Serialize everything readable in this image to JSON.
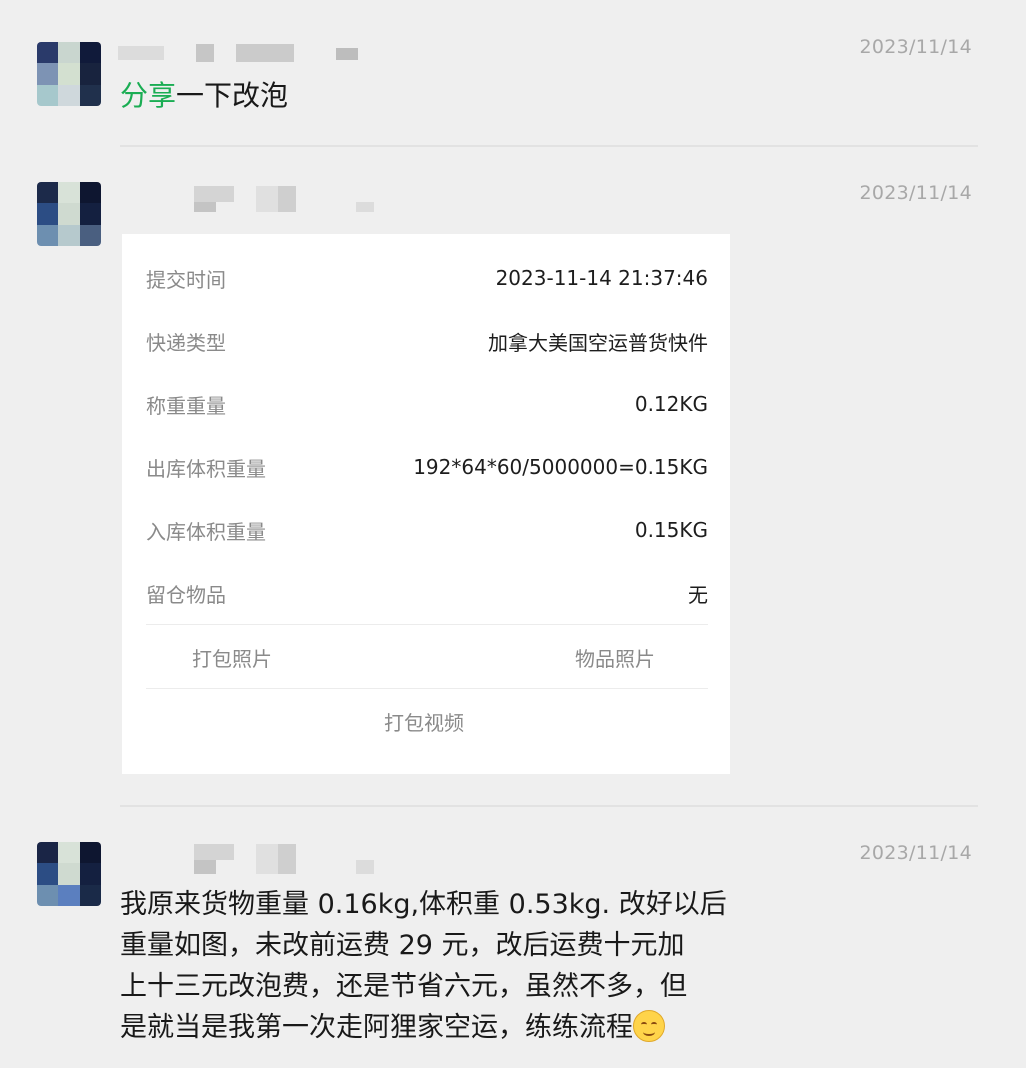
{
  "messages": [
    {
      "date": "2023/11/14",
      "text_highlight": "分享",
      "text_rest": "一下改泡"
    },
    {
      "date": "2023/11/14",
      "card": {
        "rows": [
          {
            "label": "提交时间",
            "value": "2023-11-14 21:37:46"
          },
          {
            "label": "快递类型",
            "value": "加拿大美国空运普货快件"
          },
          {
            "label": "称重重量",
            "value": "0.12KG"
          },
          {
            "label": "出库体积重量",
            "value": "192*64*60/5000000=0.15KG"
          },
          {
            "label": "入库体积重量",
            "value": "0.15KG"
          },
          {
            "label": "留仓物品",
            "value": "无"
          }
        ],
        "actions": {
          "pack_photo": "打包照片",
          "item_photo": "物品照片",
          "pack_video": "打包视频"
        }
      }
    },
    {
      "date": "2023/11/14",
      "lines": [
        "我原来货物重量 0.16kg,体积重 0.53kg. 改好以后",
        "重量如图，未改前运费 29 元，改后运费十元加",
        "上十三元改泡费，还是节省六元，虽然不多，但",
        "是就当是我第一次走阿狸家空运，练练流程"
      ],
      "emoji": "smiling-face-icon"
    }
  ]
}
